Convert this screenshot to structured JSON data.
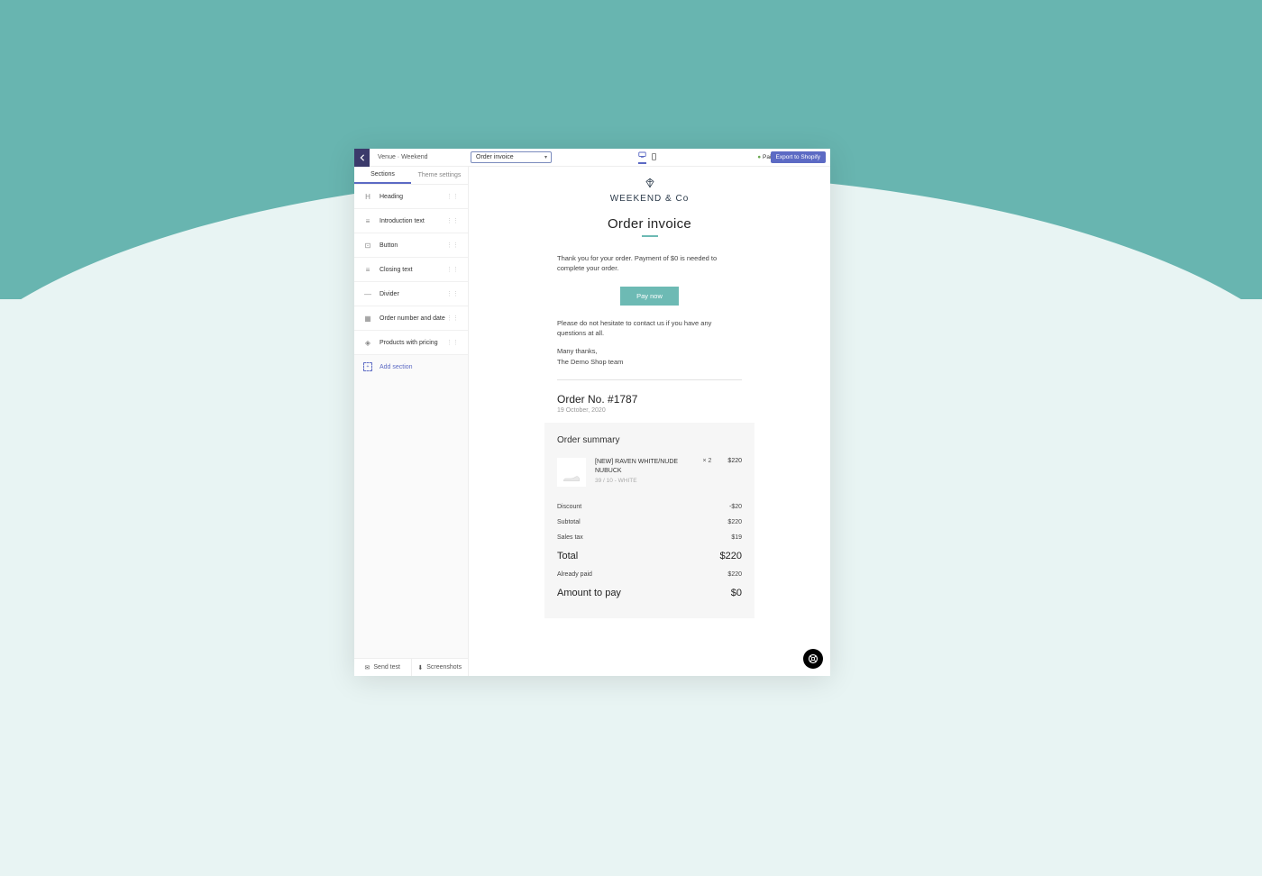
{
  "topbar": {
    "breadcrumb": "Venue · Weekend",
    "select_value": "Order invoice",
    "status": "Paid",
    "export_label": "Export to Shopify"
  },
  "sidebar": {
    "tabs": [
      "Sections",
      "Theme settings"
    ],
    "sections": [
      {
        "icon": "heading-icon",
        "glyph": "H",
        "label": "Heading"
      },
      {
        "icon": "text-icon",
        "glyph": "≡",
        "label": "Introduction text"
      },
      {
        "icon": "button-icon",
        "glyph": "⊡",
        "label": "Button"
      },
      {
        "icon": "text-icon",
        "glyph": "≡",
        "label": "Closing text"
      },
      {
        "icon": "divider-icon",
        "glyph": "—",
        "label": "Divider"
      },
      {
        "icon": "calendar-icon",
        "glyph": "▦",
        "label": "Order number and date"
      },
      {
        "icon": "tag-icon",
        "glyph": "◈",
        "label": "Products with pricing"
      }
    ],
    "add_section": "Add section",
    "footer": {
      "send_test": "Send test",
      "screenshots": "Screenshots"
    }
  },
  "invoice": {
    "brand": "WEEKEND & Co",
    "title": "Order invoice",
    "intro": "Thank you for your order. Payment of $0 is needed to complete your order.",
    "pay_label": "Pay now",
    "closing": "Please do not hesitate to contact us if you have any questions at all.",
    "thanks": "Many thanks,",
    "signature": "The Demo Shop team",
    "order_no": "Order No. #1787",
    "order_date": "19 October, 2020",
    "summary_title": "Order summary",
    "product": {
      "name": "[NEW] RAVEN WHITE/NUDE NUBUCK",
      "variant": "39 / 10 - WHITE",
      "qty": "× 2",
      "price": "$220"
    },
    "lines": [
      {
        "label": "Discount",
        "value": "-$20"
      },
      {
        "label": "Subtotal",
        "value": "$220"
      },
      {
        "label": "Sales tax",
        "value": "$19"
      }
    ],
    "total": {
      "label": "Total",
      "value": "$220"
    },
    "paid": {
      "label": "Already paid",
      "value": "$220"
    },
    "amount_to_pay": {
      "label": "Amount to pay",
      "value": "$0"
    }
  }
}
